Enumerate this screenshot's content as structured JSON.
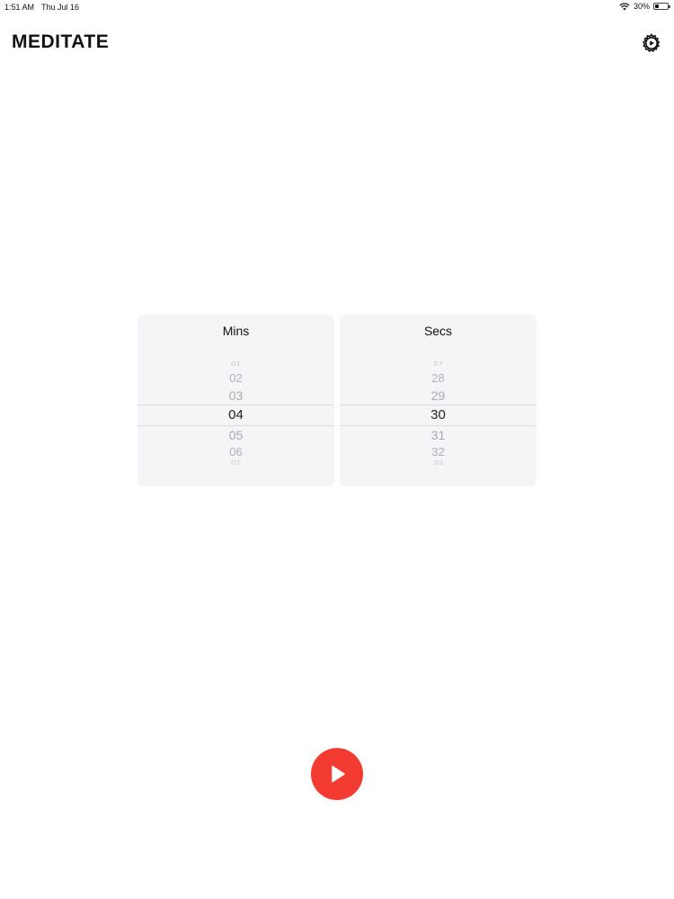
{
  "status_bar": {
    "time": "1:51 AM",
    "date": "Thu Jul 16",
    "battery_percent": "30%",
    "battery_level": 0.3
  },
  "header": {
    "title": "MEDITATE",
    "settings_icon": "gear-play-icon"
  },
  "pickers": {
    "mins": {
      "label": "Mins",
      "rows": [
        "01",
        "02",
        "03",
        "04",
        "05",
        "06",
        "07"
      ],
      "selected": "04"
    },
    "secs": {
      "label": "Secs",
      "rows": [
        "27",
        "28",
        "29",
        "30",
        "31",
        "32",
        "33"
      ],
      "selected": "30"
    }
  },
  "controls": {
    "play_icon": "play-icon",
    "accent_color": "#f43b32"
  }
}
